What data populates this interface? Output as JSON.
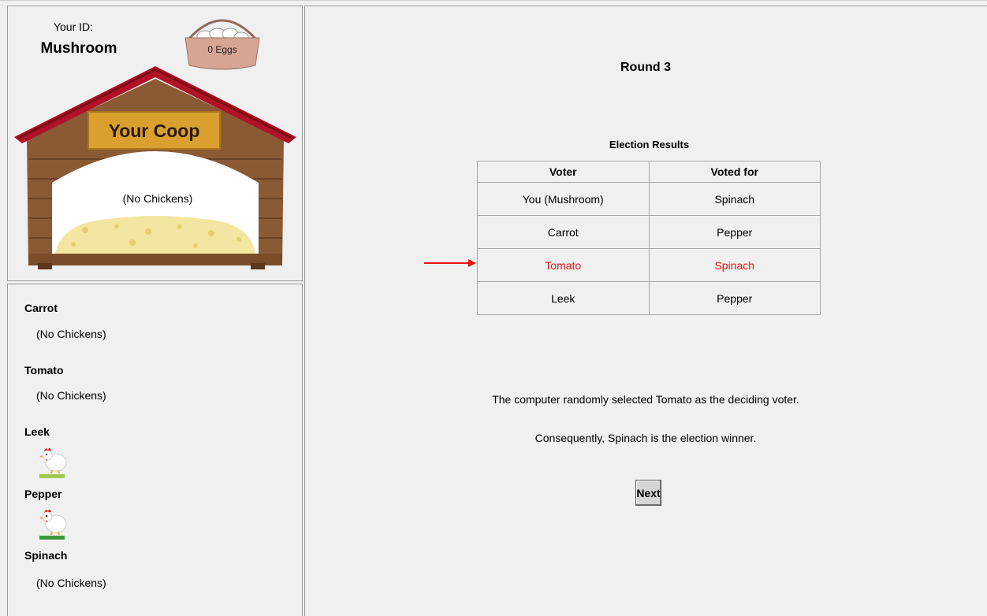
{
  "player": {
    "id_label": "Your ID:",
    "id": "Mushroom",
    "eggs_label": "0 Eggs",
    "coop_sign": "Your Coop",
    "coop_status": "(No Chickens)"
  },
  "others": [
    {
      "name": "Carrot",
      "status": "(No Chickens)",
      "chickens": 0
    },
    {
      "name": "Tomato",
      "status": "(No Chickens)",
      "chickens": 0
    },
    {
      "name": "Leek",
      "status": "",
      "chickens": 1
    },
    {
      "name": "Pepper",
      "status": "",
      "chickens": 1
    },
    {
      "name": "Spinach",
      "status": "(No Chickens)",
      "chickens": 0
    }
  ],
  "round": {
    "title": "Round 3",
    "results_title": "Election Results",
    "columns": [
      "Voter",
      "Voted for"
    ],
    "rows": [
      {
        "voter": "You (Mushroom)",
        "voted_for": "Spinach"
      },
      {
        "voter": "Carrot",
        "voted_for": "Pepper"
      },
      {
        "voter": "Tomato",
        "voted_for": "Spinach",
        "highlighted": true
      },
      {
        "voter": "Leek",
        "voted_for": "Pepper"
      }
    ],
    "message_1": "The computer randomly selected Tomato as the deciding voter.",
    "message_2": "Consequently, Spinach is the election winner.",
    "next_label": "Next"
  },
  "colors": {
    "highlight": "#ee1111",
    "roof": "#b01226",
    "wood": "#8a5a34",
    "sign": "#d9a030",
    "straw": "#f3e6a0"
  }
}
